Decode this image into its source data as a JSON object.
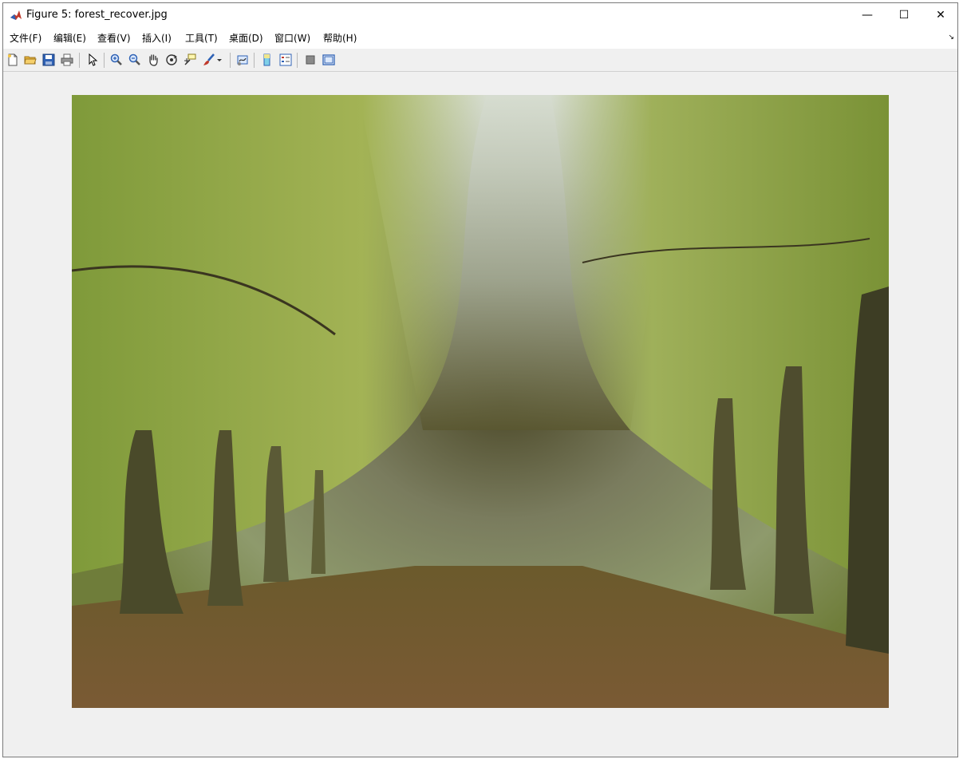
{
  "window": {
    "title": "Figure 5: forest_recover.jpg"
  },
  "controls": {
    "minimize": "—",
    "maximize": "☐",
    "close": "✕"
  },
  "menu": [
    "文件(F)",
    "编辑(E)",
    "查看(V)",
    "插入(I)",
    "工具(T)",
    "桌面(D)",
    "窗口(W)",
    "帮助(H)"
  ],
  "dock_arrow": "↘",
  "toolbar": [
    {
      "icon": "new-figure-icon"
    },
    {
      "icon": "open-file-icon"
    },
    {
      "icon": "save-icon"
    },
    {
      "icon": "print-icon"
    },
    {
      "icon": "pointer-icon"
    },
    {
      "icon": "zoom-in-icon"
    },
    {
      "icon": "zoom-out-icon"
    },
    {
      "icon": "pan-hand-icon"
    },
    {
      "icon": "rotate-3d-icon"
    },
    {
      "icon": "data-cursor-icon"
    },
    {
      "icon": "brush-icon"
    },
    {
      "icon": "brush-dropdown-icon"
    },
    {
      "icon": "link-plot-icon"
    },
    {
      "icon": "colorbar-icon"
    },
    {
      "icon": "legend-icon"
    },
    {
      "icon": "hide-plot-tools-icon"
    },
    {
      "icon": "show-plot-tools-icon"
    }
  ],
  "colors": {
    "accent_red": "#c0392b",
    "icon_blue": "#2f62b5",
    "folder_yellow": "#e8b53a",
    "frame": "#f0f0f0"
  }
}
